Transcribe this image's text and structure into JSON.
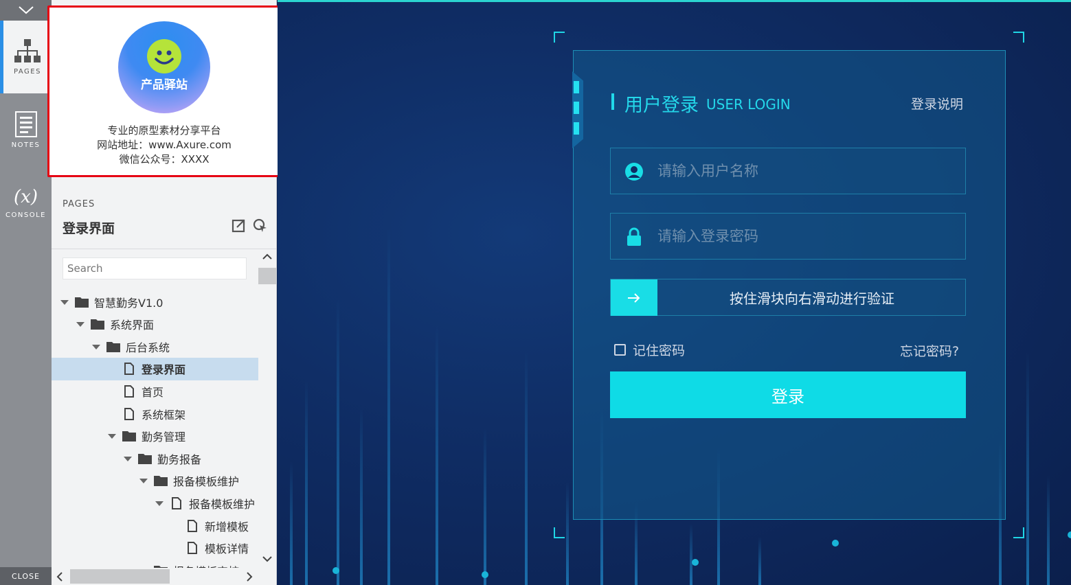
{
  "rail": {
    "tabs": [
      {
        "label": "PAGES",
        "icon": "sitemap-icon",
        "active": true
      },
      {
        "label": "NOTES",
        "icon": "notes-icon",
        "active": false
      },
      {
        "label": "CONSOLE",
        "icon": "variable-icon",
        "glyph": "(x)",
        "active": false
      }
    ],
    "close_label": "CLOSE"
  },
  "logo": {
    "brand": "产品驿站",
    "line1": "专业的原型素材分享平台",
    "line2": "网站地址：www.Axure.com",
    "line3": "微信公众号：XXXX",
    "highlight_color": "#e60012"
  },
  "pages_panel": {
    "heading": "PAGES",
    "current_page": "登录界面",
    "search_placeholder": "Search",
    "tree": [
      {
        "label": "智慧勤务V1.0",
        "type": "folder",
        "level": 0,
        "expanded": true
      },
      {
        "label": "系统界面",
        "type": "folder",
        "level": 1,
        "expanded": true
      },
      {
        "label": "后台系统",
        "type": "folder",
        "level": 2,
        "expanded": true
      },
      {
        "label": "登录界面",
        "type": "page",
        "level": 3,
        "selected": true
      },
      {
        "label": "首页",
        "type": "page",
        "level": 3
      },
      {
        "label": "系统框架",
        "type": "page",
        "level": 3
      },
      {
        "label": "勤务管理",
        "type": "folder",
        "level": 3,
        "expanded": true
      },
      {
        "label": "勤务报备",
        "type": "folder",
        "level": 4,
        "expanded": true
      },
      {
        "label": "报备模板维护",
        "type": "folder",
        "level": 5,
        "expanded": true
      },
      {
        "label": "报备模板维护",
        "type": "page",
        "level": 6,
        "expanded": true
      },
      {
        "label": "新增模板",
        "type": "page",
        "level": 7
      },
      {
        "label": "模板详情",
        "type": "page",
        "level": 7
      },
      {
        "label": "报备模板审核",
        "type": "folder",
        "level": 5
      }
    ]
  },
  "login": {
    "title_cn": "用户登录",
    "title_en": "USER LOGIN",
    "help_link": "登录说明",
    "username_placeholder": "请输入用户名称",
    "password_placeholder": "请输入登录密码",
    "slider_text": "按住滑块向右滑动进行验证",
    "remember_label": "记住密码",
    "forgot_link": "忘记密码?",
    "submit_label": "登录",
    "accent_color": "#0fdbe6"
  }
}
